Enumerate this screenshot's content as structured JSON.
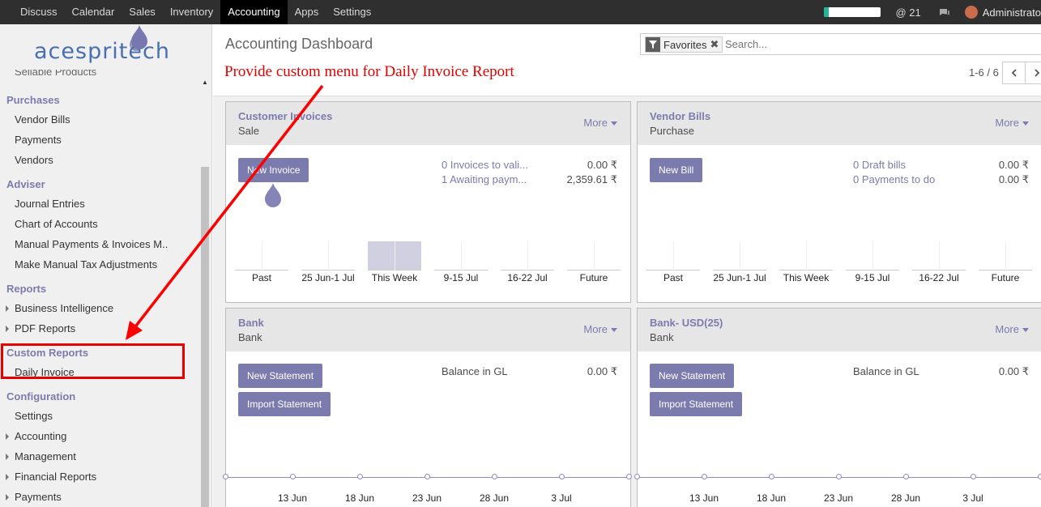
{
  "topbar": {
    "menu": [
      "Discuss",
      "Calendar",
      "Sales",
      "Inventory",
      "Accounting",
      "Apps",
      "Settings"
    ],
    "active_index": 4,
    "progress_fraction": 0.08,
    "mentions": "@ 21",
    "user": "Administrato"
  },
  "sidebar": {
    "logo_text": "acespritech",
    "cut_item": "Sellable Products",
    "sections": [
      {
        "title": "Purchases",
        "items": [
          {
            "label": "Vendor Bills",
            "caret": false
          },
          {
            "label": "Payments",
            "caret": false
          },
          {
            "label": "Vendors",
            "caret": false
          }
        ]
      },
      {
        "title": "Adviser",
        "items": [
          {
            "label": "Journal Entries",
            "caret": false
          },
          {
            "label": "Chart of Accounts",
            "caret": false
          },
          {
            "label": "Manual Payments & Invoices M..",
            "caret": false
          },
          {
            "label": "Make Manual Tax Adjustments",
            "caret": false
          }
        ]
      },
      {
        "title": "Reports",
        "items": [
          {
            "label": "Business Intelligence",
            "caret": true
          },
          {
            "label": "PDF Reports",
            "caret": true
          }
        ]
      },
      {
        "title": "Custom Reports",
        "items": [
          {
            "label": "Daily Invoice",
            "caret": false
          }
        ]
      },
      {
        "title": "Configuration",
        "items": [
          {
            "label": "Settings",
            "caret": false
          },
          {
            "label": "Accounting",
            "caret": true
          },
          {
            "label": "Management",
            "caret": true
          },
          {
            "label": "Financial Reports",
            "caret": true
          },
          {
            "label": "Payments",
            "caret": true
          }
        ]
      }
    ]
  },
  "main": {
    "title": "Accounting Dashboard",
    "annotation": "Provide custom menu for Daily Invoice Report",
    "search": {
      "facet": "Favorites",
      "placeholder": "Search..."
    },
    "pager": "1-6 / 6"
  },
  "cards": {
    "customer_invoices": {
      "name": "Customer Invoices",
      "type": "Sale",
      "more": "More",
      "button": "New Invoice",
      "links": [
        "0 Invoices to vali...",
        "1 Awaiting paym..."
      ],
      "amounts": [
        "0.00 ₹",
        "2,359.61 ₹"
      ],
      "bar_labels": [
        "Past",
        "25 Jun-1 Jul",
        "This Week",
        "9-15 Jul",
        "16-22 Jul",
        "Future"
      ]
    },
    "vendor_bills": {
      "name": "Vendor Bills",
      "type": "Purchase",
      "more": "More",
      "button": "New Bill",
      "links": [
        "0 Draft bills",
        "0 Payments to do"
      ],
      "amounts": [
        "0.00 ₹",
        "0.00 ₹"
      ],
      "bar_labels": [
        "Past",
        "25 Jun-1 Jul",
        "This Week",
        "9-15 Jul",
        "16-22 Jul",
        "Future"
      ]
    },
    "bank": {
      "name": "Bank",
      "type": "Bank",
      "more": "More",
      "buttons": [
        "New Statement",
        "Import Statement"
      ],
      "balance_label": "Balance in GL",
      "balance": "0.00 ₹",
      "x_labels": [
        "13 Jun",
        "18 Jun",
        "23 Jun",
        "28 Jun",
        "3 Jul"
      ]
    },
    "bank_usd": {
      "name": "Bank- USD(25)",
      "type": "Bank",
      "more": "More",
      "buttons": [
        "New Statement",
        "Import Statement"
      ],
      "balance_label": "Balance in GL",
      "balance": "0.00 ₹",
      "x_labels": [
        "13 Jun",
        "18 Jun",
        "23 Jun",
        "28 Jun",
        "3 Jul"
      ]
    }
  },
  "colors": {
    "accent": "#7c7bad",
    "annotation": "#e50000",
    "navbar": "#2f2f2f"
  }
}
